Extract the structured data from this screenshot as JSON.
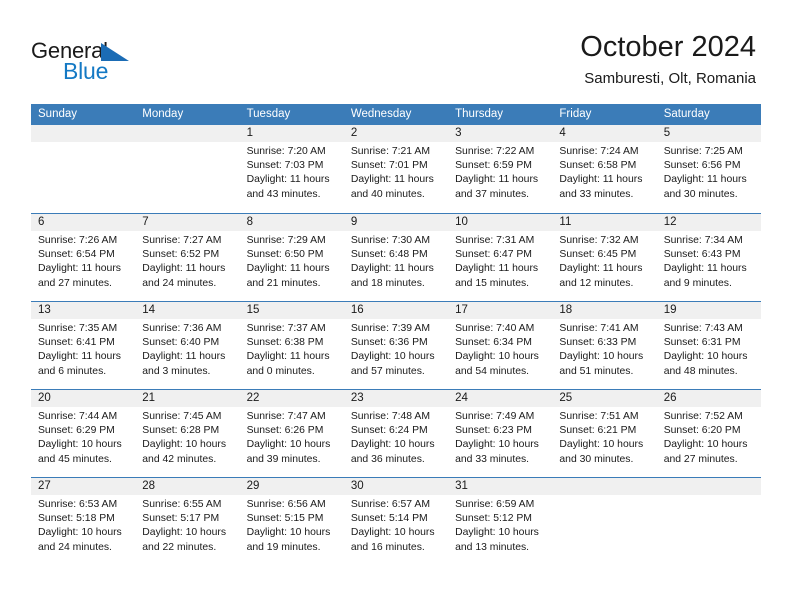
{
  "brand": {
    "name_part1": "General",
    "name_part2": "Blue",
    "accent_color": "#1479c4",
    "triangle_color": "#1b6cb5"
  },
  "header": {
    "title": "October 2024",
    "subtitle": "Samburesti, Olt, Romania"
  },
  "calendar": {
    "header_color": "#3b7cb8",
    "date_band_color": "#f0f0f0",
    "weekdays": [
      "Sunday",
      "Monday",
      "Tuesday",
      "Wednesday",
      "Thursday",
      "Friday",
      "Saturday"
    ],
    "weeks": [
      [
        {
          "day": "",
          "sunrise": "",
          "sunset": "",
          "daylight": "",
          "empty": true
        },
        {
          "day": "",
          "sunrise": "",
          "sunset": "",
          "daylight": "",
          "empty": true
        },
        {
          "day": "1",
          "sunrise": "Sunrise: 7:20 AM",
          "sunset": "Sunset: 7:03 PM",
          "daylight": "Daylight: 11 hours and 43 minutes."
        },
        {
          "day": "2",
          "sunrise": "Sunrise: 7:21 AM",
          "sunset": "Sunset: 7:01 PM",
          "daylight": "Daylight: 11 hours and 40 minutes."
        },
        {
          "day": "3",
          "sunrise": "Sunrise: 7:22 AM",
          "sunset": "Sunset: 6:59 PM",
          "daylight": "Daylight: 11 hours and 37 minutes."
        },
        {
          "day": "4",
          "sunrise": "Sunrise: 7:24 AM",
          "sunset": "Sunset: 6:58 PM",
          "daylight": "Daylight: 11 hours and 33 minutes."
        },
        {
          "day": "5",
          "sunrise": "Sunrise: 7:25 AM",
          "sunset": "Sunset: 6:56 PM",
          "daylight": "Daylight: 11 hours and 30 minutes."
        }
      ],
      [
        {
          "day": "6",
          "sunrise": "Sunrise: 7:26 AM",
          "sunset": "Sunset: 6:54 PM",
          "daylight": "Daylight: 11 hours and 27 minutes."
        },
        {
          "day": "7",
          "sunrise": "Sunrise: 7:27 AM",
          "sunset": "Sunset: 6:52 PM",
          "daylight": "Daylight: 11 hours and 24 minutes."
        },
        {
          "day": "8",
          "sunrise": "Sunrise: 7:29 AM",
          "sunset": "Sunset: 6:50 PM",
          "daylight": "Daylight: 11 hours and 21 minutes."
        },
        {
          "day": "9",
          "sunrise": "Sunrise: 7:30 AM",
          "sunset": "Sunset: 6:48 PM",
          "daylight": "Daylight: 11 hours and 18 minutes."
        },
        {
          "day": "10",
          "sunrise": "Sunrise: 7:31 AM",
          "sunset": "Sunset: 6:47 PM",
          "daylight": "Daylight: 11 hours and 15 minutes."
        },
        {
          "day": "11",
          "sunrise": "Sunrise: 7:32 AM",
          "sunset": "Sunset: 6:45 PM",
          "daylight": "Daylight: 11 hours and 12 minutes."
        },
        {
          "day": "12",
          "sunrise": "Sunrise: 7:34 AM",
          "sunset": "Sunset: 6:43 PM",
          "daylight": "Daylight: 11 hours and 9 minutes."
        }
      ],
      [
        {
          "day": "13",
          "sunrise": "Sunrise: 7:35 AM",
          "sunset": "Sunset: 6:41 PM",
          "daylight": "Daylight: 11 hours and 6 minutes."
        },
        {
          "day": "14",
          "sunrise": "Sunrise: 7:36 AM",
          "sunset": "Sunset: 6:40 PM",
          "daylight": "Daylight: 11 hours and 3 minutes."
        },
        {
          "day": "15",
          "sunrise": "Sunrise: 7:37 AM",
          "sunset": "Sunset: 6:38 PM",
          "daylight": "Daylight: 11 hours and 0 minutes."
        },
        {
          "day": "16",
          "sunrise": "Sunrise: 7:39 AM",
          "sunset": "Sunset: 6:36 PM",
          "daylight": "Daylight: 10 hours and 57 minutes."
        },
        {
          "day": "17",
          "sunrise": "Sunrise: 7:40 AM",
          "sunset": "Sunset: 6:34 PM",
          "daylight": "Daylight: 10 hours and 54 minutes."
        },
        {
          "day": "18",
          "sunrise": "Sunrise: 7:41 AM",
          "sunset": "Sunset: 6:33 PM",
          "daylight": "Daylight: 10 hours and 51 minutes."
        },
        {
          "day": "19",
          "sunrise": "Sunrise: 7:43 AM",
          "sunset": "Sunset: 6:31 PM",
          "daylight": "Daylight: 10 hours and 48 minutes."
        }
      ],
      [
        {
          "day": "20",
          "sunrise": "Sunrise: 7:44 AM",
          "sunset": "Sunset: 6:29 PM",
          "daylight": "Daylight: 10 hours and 45 minutes."
        },
        {
          "day": "21",
          "sunrise": "Sunrise: 7:45 AM",
          "sunset": "Sunset: 6:28 PM",
          "daylight": "Daylight: 10 hours and 42 minutes."
        },
        {
          "day": "22",
          "sunrise": "Sunrise: 7:47 AM",
          "sunset": "Sunset: 6:26 PM",
          "daylight": "Daylight: 10 hours and 39 minutes."
        },
        {
          "day": "23",
          "sunrise": "Sunrise: 7:48 AM",
          "sunset": "Sunset: 6:24 PM",
          "daylight": "Daylight: 10 hours and 36 minutes."
        },
        {
          "day": "24",
          "sunrise": "Sunrise: 7:49 AM",
          "sunset": "Sunset: 6:23 PM",
          "daylight": "Daylight: 10 hours and 33 minutes."
        },
        {
          "day": "25",
          "sunrise": "Sunrise: 7:51 AM",
          "sunset": "Sunset: 6:21 PM",
          "daylight": "Daylight: 10 hours and 30 minutes."
        },
        {
          "day": "26",
          "sunrise": "Sunrise: 7:52 AM",
          "sunset": "Sunset: 6:20 PM",
          "daylight": "Daylight: 10 hours and 27 minutes."
        }
      ],
      [
        {
          "day": "27",
          "sunrise": "Sunrise: 6:53 AM",
          "sunset": "Sunset: 5:18 PM",
          "daylight": "Daylight: 10 hours and 24 minutes."
        },
        {
          "day": "28",
          "sunrise": "Sunrise: 6:55 AM",
          "sunset": "Sunset: 5:17 PM",
          "daylight": "Daylight: 10 hours and 22 minutes."
        },
        {
          "day": "29",
          "sunrise": "Sunrise: 6:56 AM",
          "sunset": "Sunset: 5:15 PM",
          "daylight": "Daylight: 10 hours and 19 minutes."
        },
        {
          "day": "30",
          "sunrise": "Sunrise: 6:57 AM",
          "sunset": "Sunset: 5:14 PM",
          "daylight": "Daylight: 10 hours and 16 minutes."
        },
        {
          "day": "31",
          "sunrise": "Sunrise: 6:59 AM",
          "sunset": "Sunset: 5:12 PM",
          "daylight": "Daylight: 10 hours and 13 minutes."
        },
        {
          "day": "",
          "sunrise": "",
          "sunset": "",
          "daylight": "",
          "empty": true
        },
        {
          "day": "",
          "sunrise": "",
          "sunset": "",
          "daylight": "",
          "empty": true
        }
      ]
    ]
  }
}
